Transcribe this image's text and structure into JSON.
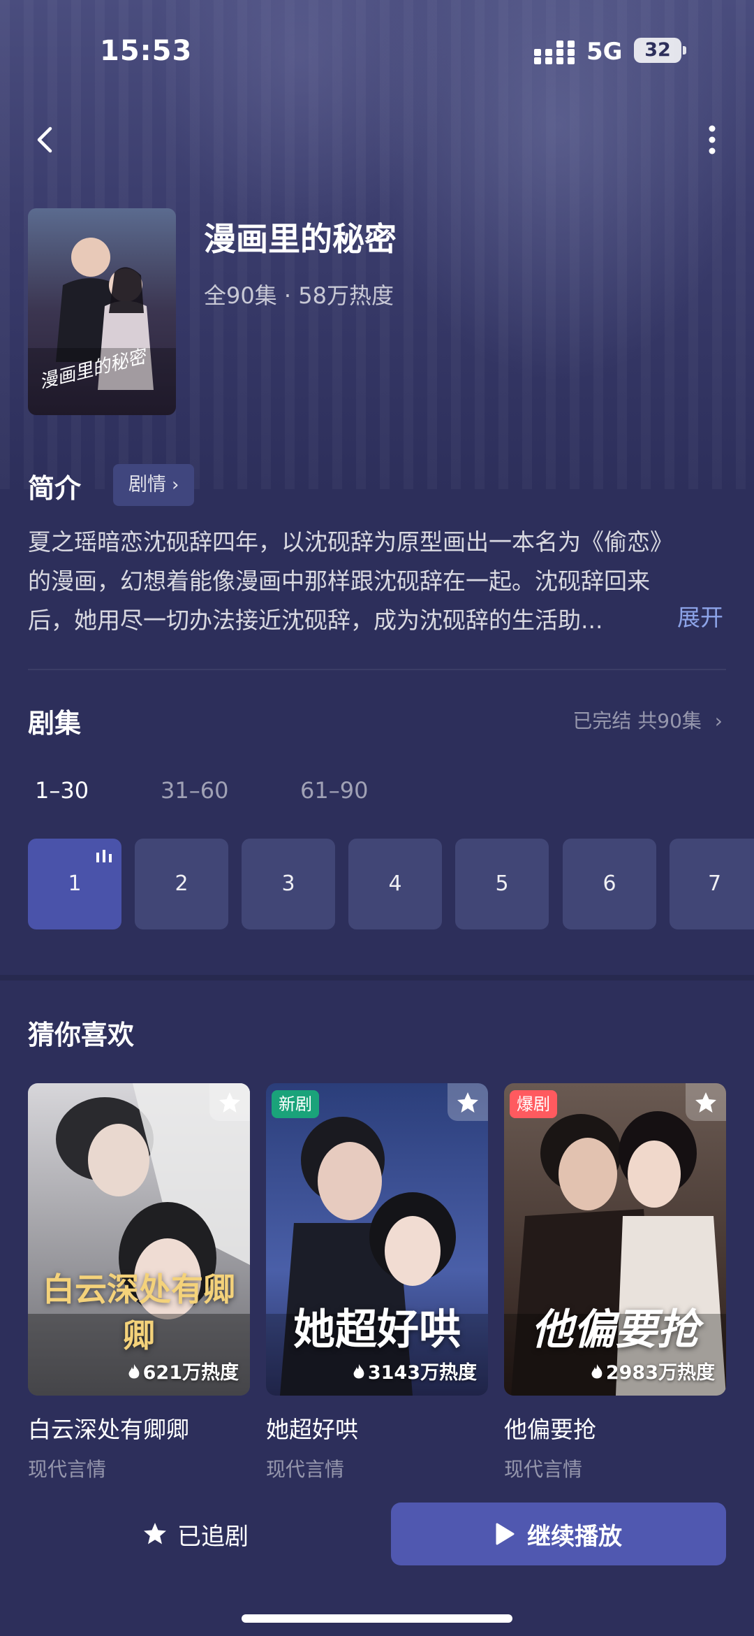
{
  "status_bar": {
    "time": "15:53",
    "network": "5G",
    "battery": "32"
  },
  "show": {
    "title": "漫画里的秘密",
    "meta": "全90集 · 58万热度",
    "cover_caption": "漫画里的秘密"
  },
  "synopsis": {
    "label": "简介",
    "genre_chip": "剧情",
    "lines": [
      "夏之瑶暗恋沈砚辞四年，以沈砚辞为原型画出一本名为《偷恋》",
      "的漫画，幻想着能像漫画中那样跟沈砚辞在一起。沈砚辞回来",
      "后，她用尽一切办法接近沈砚辞，成为沈砚辞的生活助..."
    ],
    "expand": "展开"
  },
  "episodes": {
    "label": "剧集",
    "status": "已完结 共90集",
    "ranges": [
      "1–30",
      "31–60",
      "61–90"
    ],
    "active_range": 0,
    "tiles": [
      "1",
      "2",
      "3",
      "4",
      "5",
      "6",
      "7"
    ],
    "current_episode": "1"
  },
  "recommendations": {
    "label": "猜你喜欢",
    "items": [
      {
        "name": "白云深处有卿卿",
        "genre": "现代言情",
        "heat": "621万热度",
        "poster_title": "白云深处有卿卿",
        "tag": "",
        "tag_color": ""
      },
      {
        "name": "她超好哄",
        "genre": "现代言情",
        "heat": "3143万热度",
        "poster_title": "她超好哄",
        "tag": "新剧",
        "tag_color": "#1aa37a"
      },
      {
        "name": "他偏要抢",
        "genre": "现代言情",
        "heat": "2983万热度",
        "poster_title": "他偏要抢",
        "tag": "爆剧",
        "tag_color": "#ff5a5f"
      }
    ]
  },
  "bottom_bar": {
    "follow_label": "已追剧",
    "play_label": "继续播放"
  },
  "colors": {
    "background": "#2d2f5b",
    "accent": "#5058b0",
    "link": "#8da4e9",
    "tile": "#414676"
  },
  "icons": [
    "back-icon",
    "more-icon",
    "chevron-right-icon",
    "star-icon",
    "play-icon",
    "flame-icon",
    "playing-bars-icon"
  ]
}
